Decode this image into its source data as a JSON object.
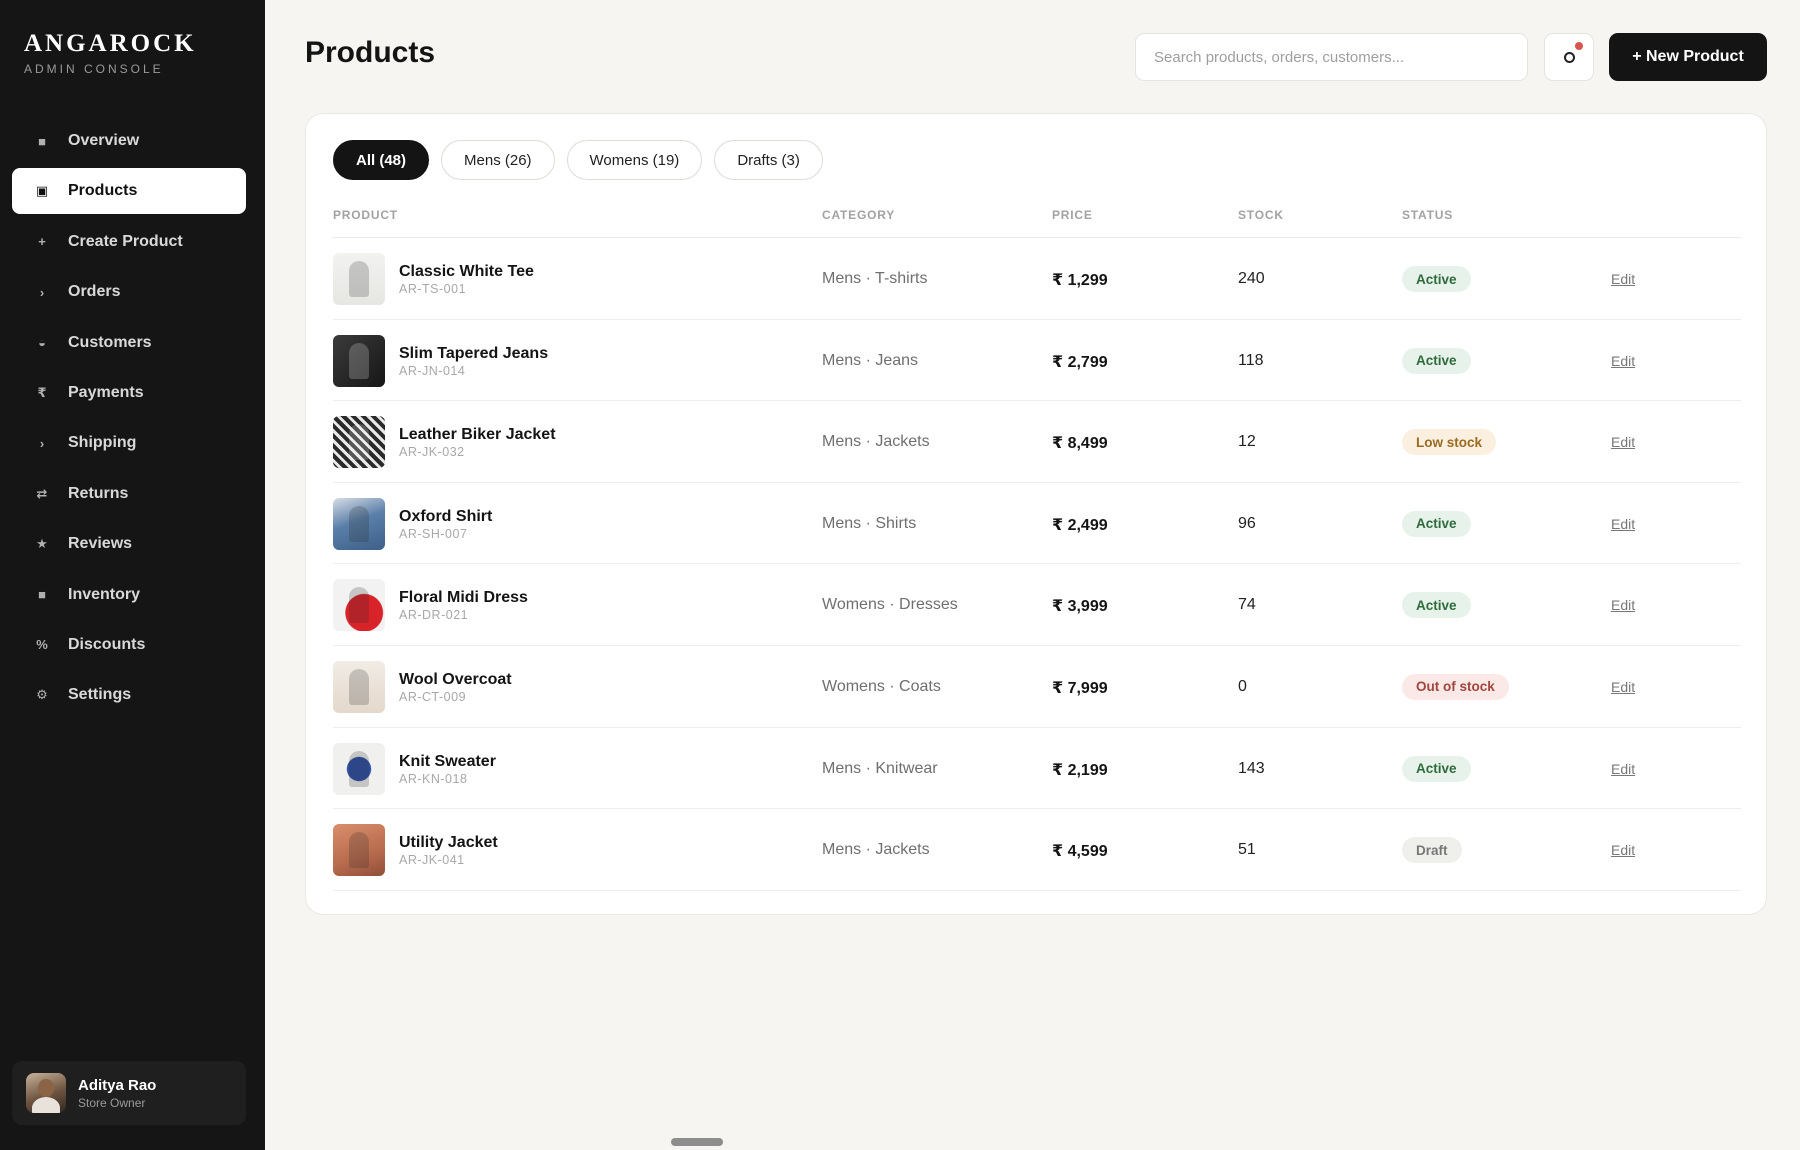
{
  "brand": {
    "name": "ANGAROCK",
    "subtitle": "ADMIN CONSOLE"
  },
  "nav": [
    {
      "label": "Overview",
      "icon": "square-icon",
      "glyph": "■",
      "active": false
    },
    {
      "label": "Products",
      "icon": "box-icon",
      "glyph": "▣",
      "active": true
    },
    {
      "label": "Create Product",
      "icon": "plus-icon",
      "glyph": "+",
      "active": false
    },
    {
      "label": "Orders",
      "icon": "chevron-right-icon",
      "glyph": "›",
      "active": false
    },
    {
      "label": "Customers",
      "icon": "half-circle-icon",
      "glyph": "◒",
      "active": false
    },
    {
      "label": "Payments",
      "icon": "rupee-icon",
      "glyph": "₹",
      "active": false
    },
    {
      "label": "Shipping",
      "icon": "chevron-right-icon",
      "glyph": "›",
      "active": false
    },
    {
      "label": "Returns",
      "icon": "swap-icon",
      "glyph": "⇄",
      "active": false
    },
    {
      "label": "Reviews",
      "icon": "star-icon",
      "glyph": "★",
      "active": false
    },
    {
      "label": "Inventory",
      "icon": "square-icon",
      "glyph": "■",
      "active": false
    },
    {
      "label": "Discounts",
      "icon": "percent-icon",
      "glyph": "%",
      "active": false
    },
    {
      "label": "Settings",
      "icon": "gear-icon",
      "glyph": "⚙",
      "active": false
    }
  ],
  "user": {
    "name": "Aditya Rao",
    "role": "Store Owner"
  },
  "header": {
    "title": "Products",
    "search_placeholder": "Search products, orders, customers...",
    "new_button": "+ New Product"
  },
  "tabs": [
    {
      "label": "All (48)",
      "active": true
    },
    {
      "label": "Mens (26)",
      "active": false
    },
    {
      "label": "Womens (19)",
      "active": false
    },
    {
      "label": "Drafts (3)",
      "active": false
    }
  ],
  "columns": [
    "PRODUCT",
    "CATEGORY",
    "PRICE",
    "STOCK",
    "STATUS"
  ],
  "edit_label": "Edit",
  "products": [
    {
      "name": "Classic White Tee",
      "sku": "AR-TS-001",
      "category": "Mens · T-shirts",
      "price": "₹ 1,299",
      "stock": "240",
      "status": "Active",
      "status_kind": "active",
      "thumb": "t-tee"
    },
    {
      "name": "Slim Tapered Jeans",
      "sku": "AR-JN-014",
      "category": "Mens · Jeans",
      "price": "₹ 2,799",
      "stock": "118",
      "status": "Active",
      "status_kind": "active",
      "thumb": "t-jeans"
    },
    {
      "name": "Leather Biker Jacket",
      "sku": "AR-JK-032",
      "category": "Mens · Jackets",
      "price": "₹ 8,499",
      "stock": "12",
      "status": "Low stock",
      "status_kind": "low",
      "thumb": "t-jacket"
    },
    {
      "name": "Oxford Shirt",
      "sku": "AR-SH-007",
      "category": "Mens · Shirts",
      "price": "₹ 2,499",
      "stock": "96",
      "status": "Active",
      "status_kind": "active",
      "thumb": "t-oxford"
    },
    {
      "name": "Floral Midi Dress",
      "sku": "AR-DR-021",
      "category": "Womens · Dresses",
      "price": "₹ 3,999",
      "stock": "74",
      "status": "Active",
      "status_kind": "active",
      "thumb": "t-dress"
    },
    {
      "name": "Wool Overcoat",
      "sku": "AR-CT-009",
      "category": "Womens · Coats",
      "price": "₹ 7,999",
      "stock": "0",
      "status": "Out of stock",
      "status_kind": "out",
      "thumb": "t-coat"
    },
    {
      "name": "Knit Sweater",
      "sku": "AR-KN-018",
      "category": "Mens · Knitwear",
      "price": "₹ 2,199",
      "stock": "143",
      "status": "Active",
      "status_kind": "active",
      "thumb": "t-sweater"
    },
    {
      "name": "Utility Jacket",
      "sku": "AR-JK-041",
      "category": "Mens · Jackets",
      "price": "₹ 4,599",
      "stock": "51",
      "status": "Draft",
      "status_kind": "draft",
      "thumb": "t-utility"
    }
  ],
  "colors": {
    "sidebar": "#151515",
    "background": "#f6f5f2",
    "primary_button": "#141414",
    "notification_dot": "#d9534f"
  }
}
